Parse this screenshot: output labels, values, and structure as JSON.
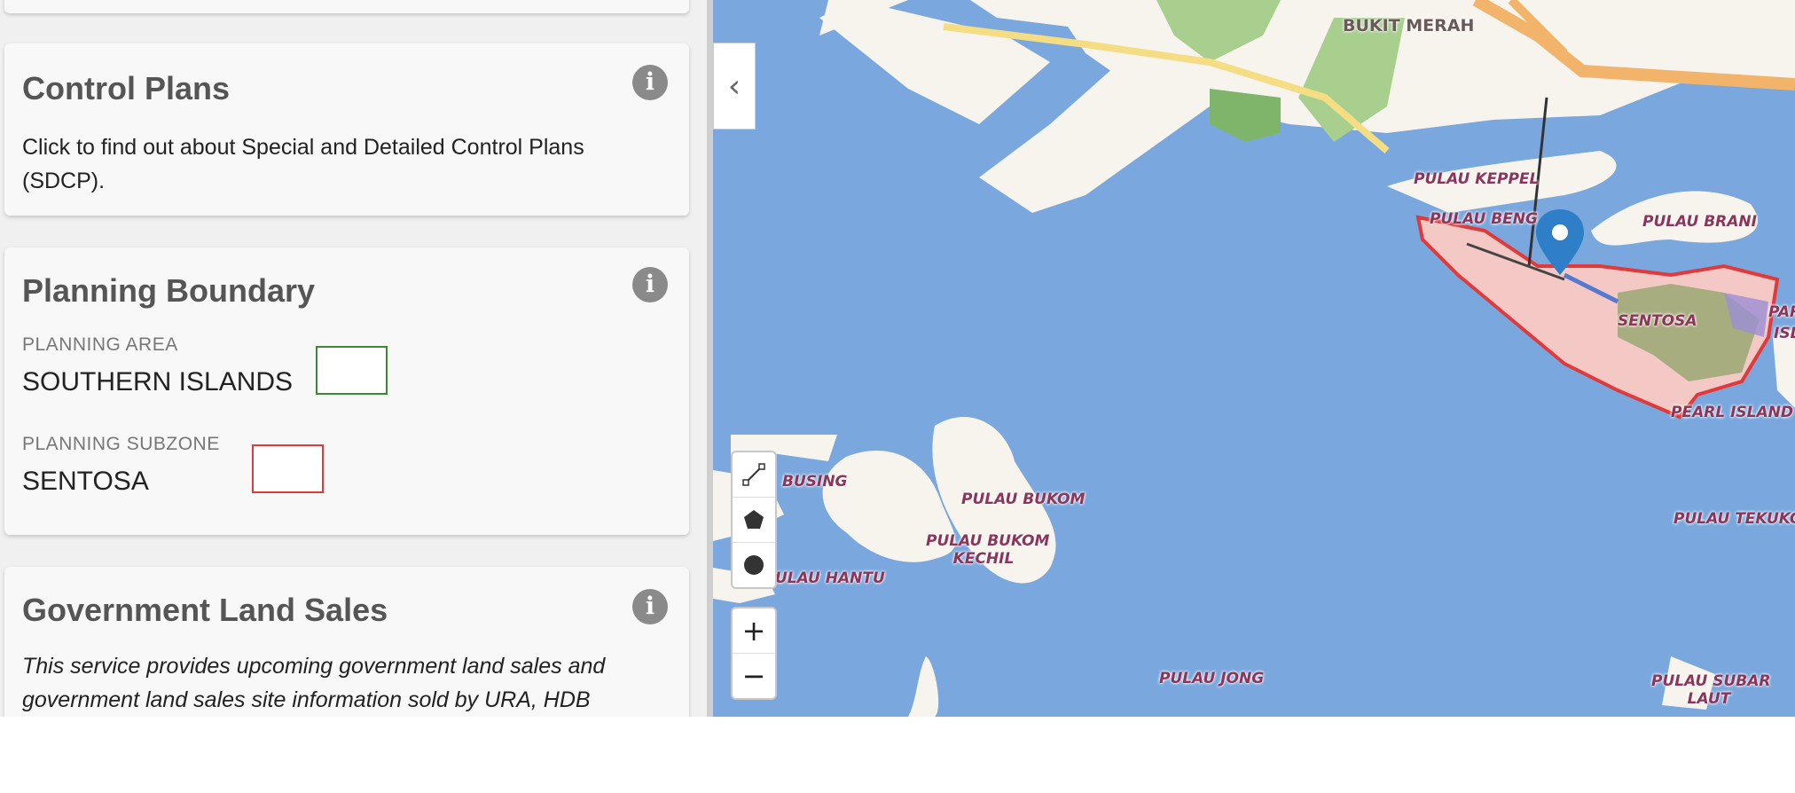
{
  "control_plans": {
    "title": "Control Plans",
    "description": "Click to find out about Special and Detailed Control Plans (SDCP)."
  },
  "planning_boundary": {
    "title": "Planning Boundary",
    "area_label": "PLANNING AREA",
    "area_value": "SOUTHERN ISLANDS",
    "area_color": "#3a8a2f",
    "subzone_label": "PLANNING SUBZONE",
    "subzone_value": "SENTOSA",
    "subzone_color": "#e03a3a"
  },
  "gls": {
    "title": "Government Land Sales",
    "description": "This service provides upcoming government land sales and government land sales site information sold by URA, HDB"
  },
  "info_icon_glyph": "i",
  "map": {
    "collapse_glyph": "‹",
    "tools": [
      "draw-line-icon",
      "draw-polygon-icon",
      "draw-circle-icon"
    ],
    "zoom_in": "+",
    "zoom_out": "−",
    "colors": {
      "water": "#7aa8de",
      "land": "#f7f4ee",
      "park": "#a9cf8f",
      "subzone_outline": "#e03a3a",
      "subzone_fill": "#f4c8c4",
      "marker": "#2f7fc8"
    },
    "labels": {
      "bukit_merah": "BUKIT MERAH",
      "pulau_keppel": "PULAU KEPPEL",
      "pulau_bengkak": "PULAU BENG",
      "pulau_brani": "PULAU BRANI",
      "sentosa": "SENTOSA",
      "pearl_island": "PEARL ISLAND",
      "pulau_busing": "BUSING",
      "pulau_bukom": "PULAU BUKOM",
      "pulau_bukom_kechil_1": "PULAU BUKOM",
      "pulau_bukom_kechil_2": "KECHIL",
      "pulau_hantu": "ULAU HANTU",
      "pulau_tekukor": "PULAU TEKUKO",
      "pulau_jong": "PULAU JONG",
      "pulau_subar_laut_1": "PULAU SUBAR",
      "pulau_subar_laut_2": "LAUT",
      "pulau_edge_1": "PAR",
      "pulau_edge_2": "ISL"
    }
  }
}
